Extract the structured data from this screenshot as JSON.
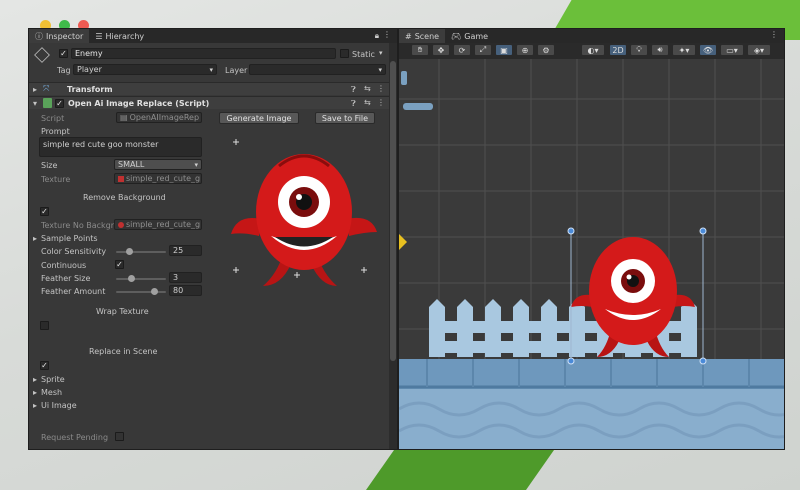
{
  "window": {
    "traffic_lights": [
      "#f0c034",
      "#3fbb4a",
      "#ee5a52"
    ]
  },
  "inspector": {
    "tabs": [
      {
        "label": "Inspector",
        "icon": "info-icon"
      },
      {
        "label": "Hierarchy",
        "icon": "list-icon"
      }
    ],
    "object": {
      "name": "Enemy",
      "static_label": "Static",
      "tag_label": "Tag",
      "tag_value": "Player",
      "layer_label": "Layer",
      "layer_value": ""
    },
    "transform": {
      "title": "Transform"
    },
    "component": {
      "title": "Open Ai Image Replace (Script)",
      "script_label": "Script",
      "script_value": "OpenAIImageRep",
      "generate_button": "Generate Image",
      "save_button": "Save to File",
      "prompt_label": "Prompt",
      "prompt_value": "simple red cute goo monster",
      "size_label": "Size",
      "size_value": "SMALL",
      "texture_label": "Texture",
      "texture_value": "simple_red_cute_g",
      "remove_background_label": "Remove Background",
      "texture_no_bg_label": "Texture No Backgr",
      "texture_no_bg_value": "simple_red_cute_g",
      "sample_points_label": "Sample Points",
      "color_sensitivity_label": "Color Sensitivity",
      "color_sensitivity_value": "25",
      "continuous_label": "Continuous",
      "feather_size_label": "Feather Size",
      "feather_size_value": "3",
      "feather_amount_label": "Feather Amount",
      "feather_amount_value": "80",
      "wrap_texture_label": "Wrap Texture",
      "replace_in_scene_label": "Replace in Scene",
      "sprite_label": "Sprite",
      "mesh_label": "Mesh",
      "ui_image_label": "Ui Image",
      "request_pending_label": "Request Pending"
    }
  },
  "scene": {
    "tabs": [
      {
        "label": "Scene",
        "icon": "grid-icon"
      },
      {
        "label": "Game",
        "icon": "gamepad-icon"
      }
    ],
    "toolbar_2d_label": "2D"
  },
  "colors": {
    "monster_red": "#d41a1a",
    "fence": "#a9c8e0",
    "ground": "#6e98bd",
    "water": "#89aecd"
  }
}
